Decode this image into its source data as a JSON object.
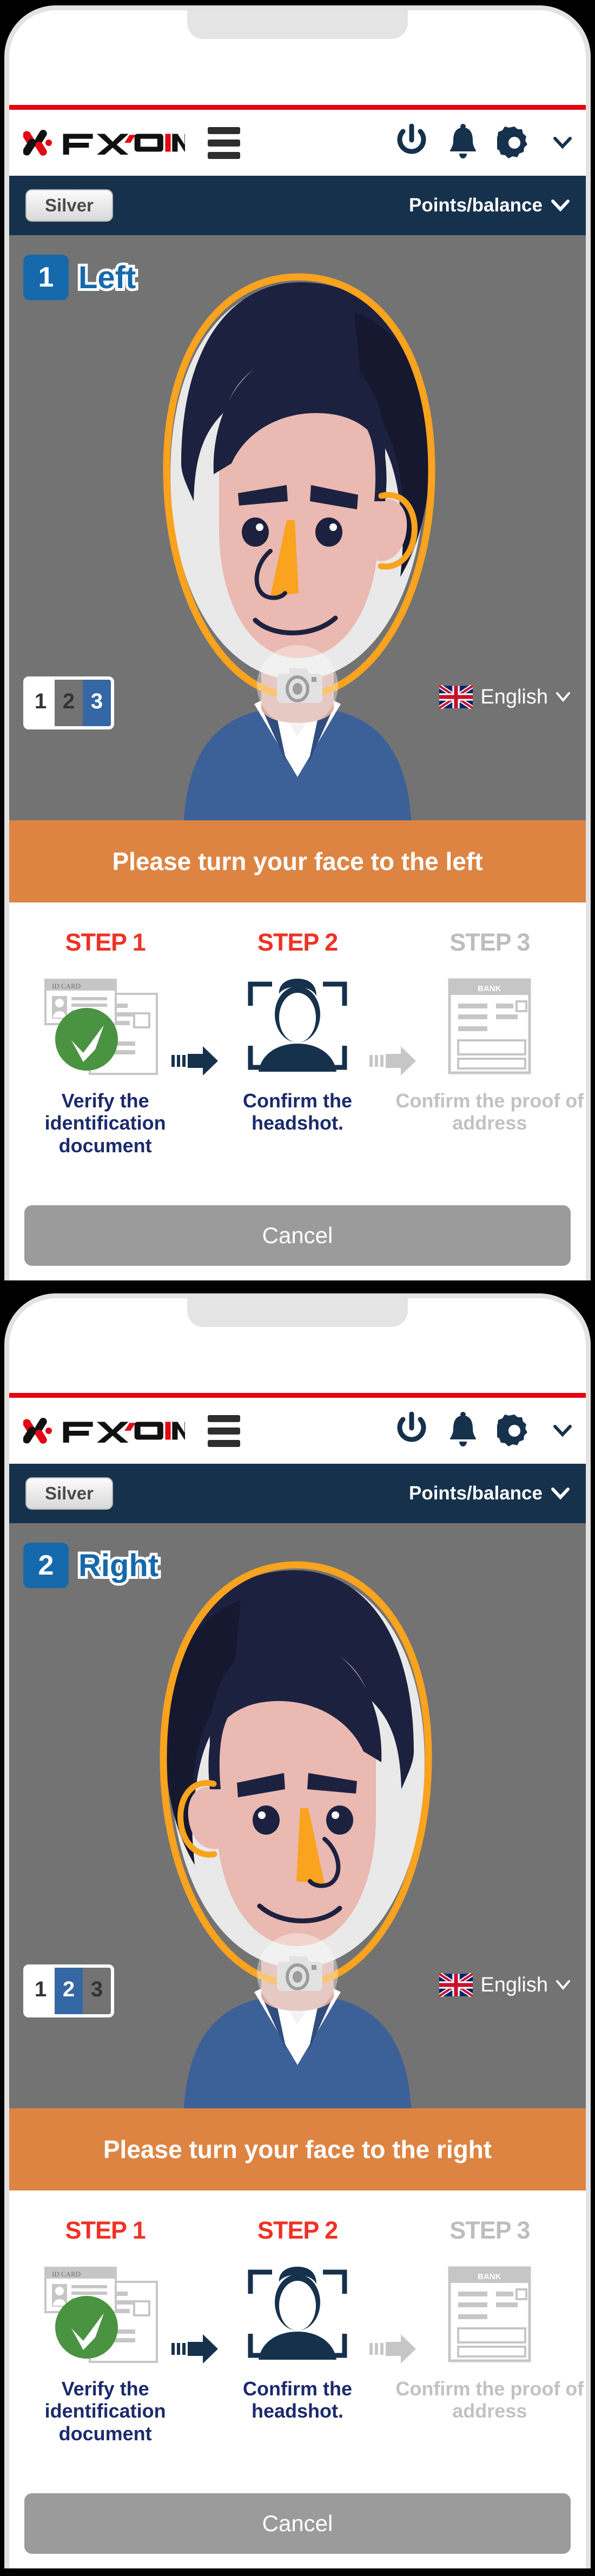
{
  "brand": {
    "logo_text": "FXON",
    "accent_red": "#e30613",
    "navy": "#16314c",
    "blue": "#1569ab",
    "orange": "#dd8443",
    "step_red": "#ef3124",
    "green": "#4a9340"
  },
  "header": {
    "menu_icon": "hamburger-icon",
    "power_icon": "power-icon",
    "bell_icon": "bell-icon",
    "gear_icon": "gear-icon",
    "chevron_icon": "chevron-down-icon"
  },
  "account_bar": {
    "rank_label": "Silver",
    "points_label": "Points/balance",
    "chevron": "chevron-down-icon"
  },
  "camera": {
    "shutter_icon": "camera-icon",
    "language": {
      "flag": "uk-flag-icon",
      "label": "English",
      "chevron": "chevron-down-icon"
    }
  },
  "panels": [
    {
      "step_number": "1",
      "direction_label": "Left",
      "instruction": "Please turn your face to the left",
      "pager": [
        "1",
        "2",
        "3"
      ],
      "pager_active_index": 2,
      "face_mirrored": false
    },
    {
      "step_number": "2",
      "direction_label": "Right",
      "instruction": "Please turn your face to the right",
      "pager": [
        "1",
        "2",
        "3"
      ],
      "pager_active_index": 1,
      "face_mirrored": true
    }
  ],
  "steps": [
    {
      "title": "STEP 1",
      "caption": "Verify the identification document",
      "state": "active",
      "art": "id-card-verified-icon",
      "art_label": "ID CARD"
    },
    {
      "title": "STEP 2",
      "caption": "Confirm the headshot.",
      "state": "active",
      "art": "headshot-scan-icon",
      "art_label": ""
    },
    {
      "title": "STEP 3",
      "caption": "Confirm the proof of address",
      "state": "muted",
      "art": "bank-statement-icon",
      "art_label": "BANK"
    }
  ],
  "footer": {
    "cancel_label": "Cancel"
  }
}
